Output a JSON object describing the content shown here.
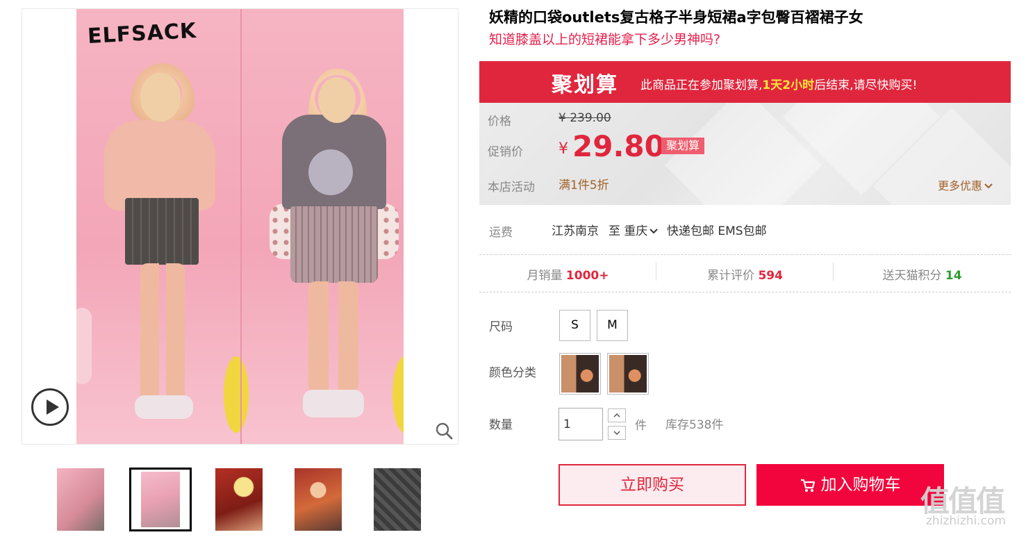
{
  "gallery": {
    "brand_logo": "ELFSACK",
    "thumbnail_count": 5,
    "active_thumbnail": 2
  },
  "product": {
    "title": "妖精的口袋outlets复古格子半身短裙a字包臀百褶裙子女",
    "subtitle": "知道膝盖以上的短裙能拿下多少男神吗?"
  },
  "juhuasuan": {
    "logo": "聚划算",
    "text_before": "此商品正在参加聚划算,",
    "countdown": "1天2小时",
    "text_after": "后结束,请尽快购买!"
  },
  "price": {
    "price_label": "价格",
    "original_price": "¥ 239.00",
    "promo_label": "促销价",
    "currency": "¥",
    "promo_price": "29.80",
    "promo_tag": "聚划算",
    "activity_label": "本店活动",
    "activity": "满1件5折",
    "more_deals": "更多优惠"
  },
  "shipping": {
    "label": "运费",
    "from": "江苏南京",
    "to": "至 重庆",
    "options": "快递包邮 EMS包邮"
  },
  "stats": {
    "monthly_sales_label": "月销量",
    "monthly_sales": "1000+",
    "reviews_label": "累计评价",
    "reviews": "594",
    "points_label": "送天猫积分",
    "points": "14"
  },
  "options": {
    "size_label": "尺码",
    "sizes": [
      "S",
      "M"
    ],
    "color_label": "颜色分类",
    "quantity_label": "数量",
    "quantity": "1",
    "unit": "件",
    "stock": "库存538件"
  },
  "actions": {
    "buy_now": "立即购买",
    "add_to_cart": "加入购物车"
  },
  "watermark": {
    "mark": "值值值",
    "site": "zhizhizhi.com"
  },
  "colors": {
    "accent_red": "#e0263d",
    "cart_red": "#f2053c",
    "activity_brown": "#a0612a",
    "points_green": "#2e9d2e",
    "countdown_yellow": "#ffe43a"
  }
}
